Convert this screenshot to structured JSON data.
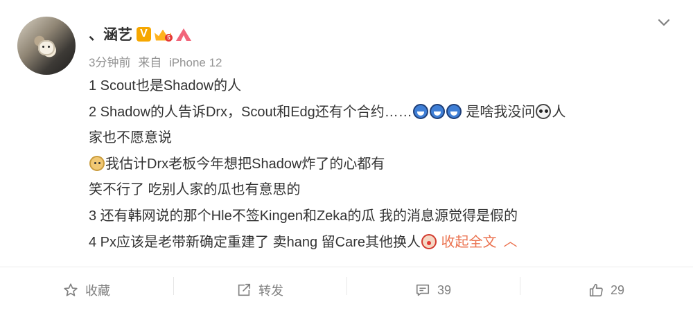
{
  "post": {
    "author": {
      "name": "、涵艺",
      "badges": [
        "vip-v-badge",
        "crown-badge",
        "fan-badge"
      ]
    },
    "meta": {
      "time": "3分钟前",
      "source_prefix": "来自",
      "source": "iPhone 12"
    },
    "content": {
      "line1": "1 Scout也是Shadow的人",
      "line2_text": "2 Shadow的人告诉Drx，Scout和Edg还有个合约……",
      "line2_after": " 是啥我没问",
      "line2_end": "人",
      "line3": "家也不愿意说",
      "line4": "我估计Drx老板今年想把Shadow炸了的心都有",
      "line5": "笑不行了 吃别人家的瓜也有意思的",
      "line6": "3 还有韩网说的那个Hle不签Kingen和Zeka的瓜 我的消息源觉得是假的",
      "line7": "4 Px应该是老带新确定重建了 卖hang 留Care其他换人",
      "collapse_label": "收起全文",
      "collapse_caret": "︿"
    },
    "actions": {
      "favorite_label": "收藏",
      "repost_label": "转发",
      "comment_count": "39",
      "like_count": "29"
    }
  },
  "colors": {
    "accent": "#eb7350",
    "text": "#333333",
    "muted": "#939393",
    "vip_badge": "#f6a700"
  }
}
